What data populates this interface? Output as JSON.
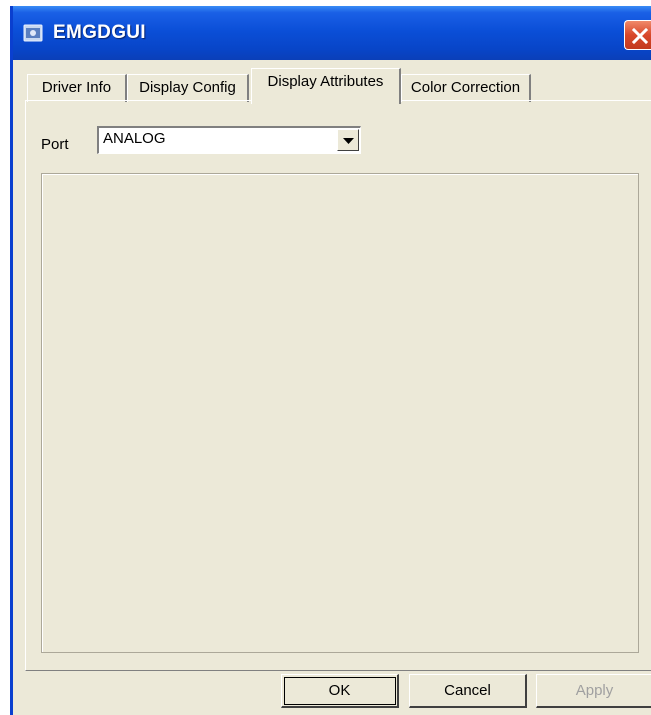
{
  "window": {
    "title": "EMGDGUI"
  },
  "tabs": [
    {
      "label": "Driver Info",
      "active": false
    },
    {
      "label": "Display Config",
      "active": false
    },
    {
      "label": "Display Attributes",
      "active": true
    },
    {
      "label": "Color Correction",
      "active": false
    }
  ],
  "port": {
    "label": "Port",
    "selected": "ANALOG"
  },
  "buttons": {
    "ok": "OK",
    "cancel": "Cancel",
    "apply": "Apply"
  },
  "icons": {
    "app": "app-window-icon",
    "close": "close-icon",
    "dropdown": "chevron-down-icon"
  },
  "colors": {
    "titlebar": "#0b4fd8",
    "window_bg": "#ece9d8",
    "close": "#d8472a"
  }
}
